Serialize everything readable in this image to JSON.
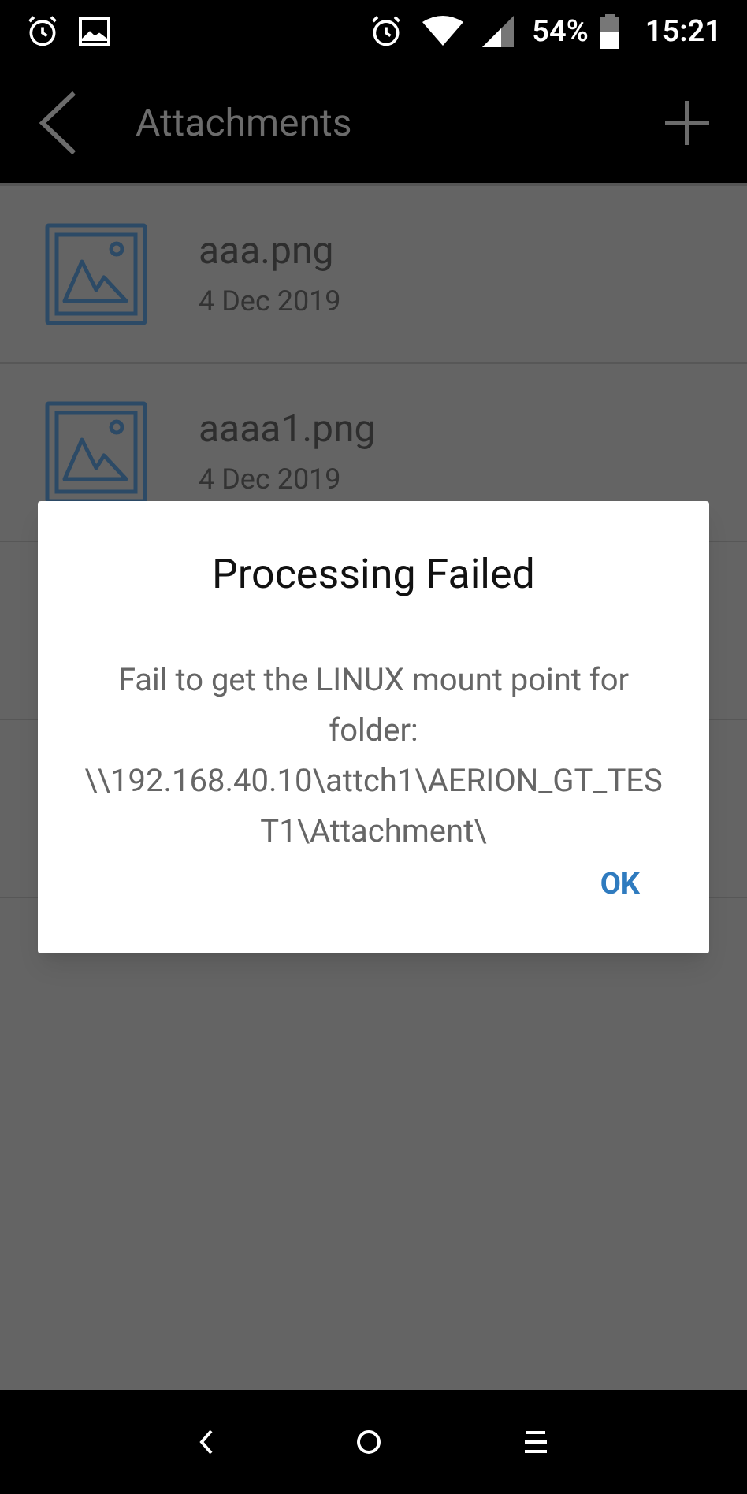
{
  "status_bar": {
    "battery": "54%",
    "time": "15:21"
  },
  "app_bar": {
    "title": "Attachments"
  },
  "attachments": [
    {
      "name": "aaa.png",
      "date": "4 Dec 2019"
    },
    {
      "name": "aaaa1.png",
      "date": "4 Dec 2019"
    }
  ],
  "dialog": {
    "title": "Processing Failed",
    "message": "Fail to get the LINUX mount point for folder: \\\\192.168.40.10\\attch1\\AERION_GT_TEST1\\Attachment\\",
    "buttons": [
      "OK"
    ]
  }
}
